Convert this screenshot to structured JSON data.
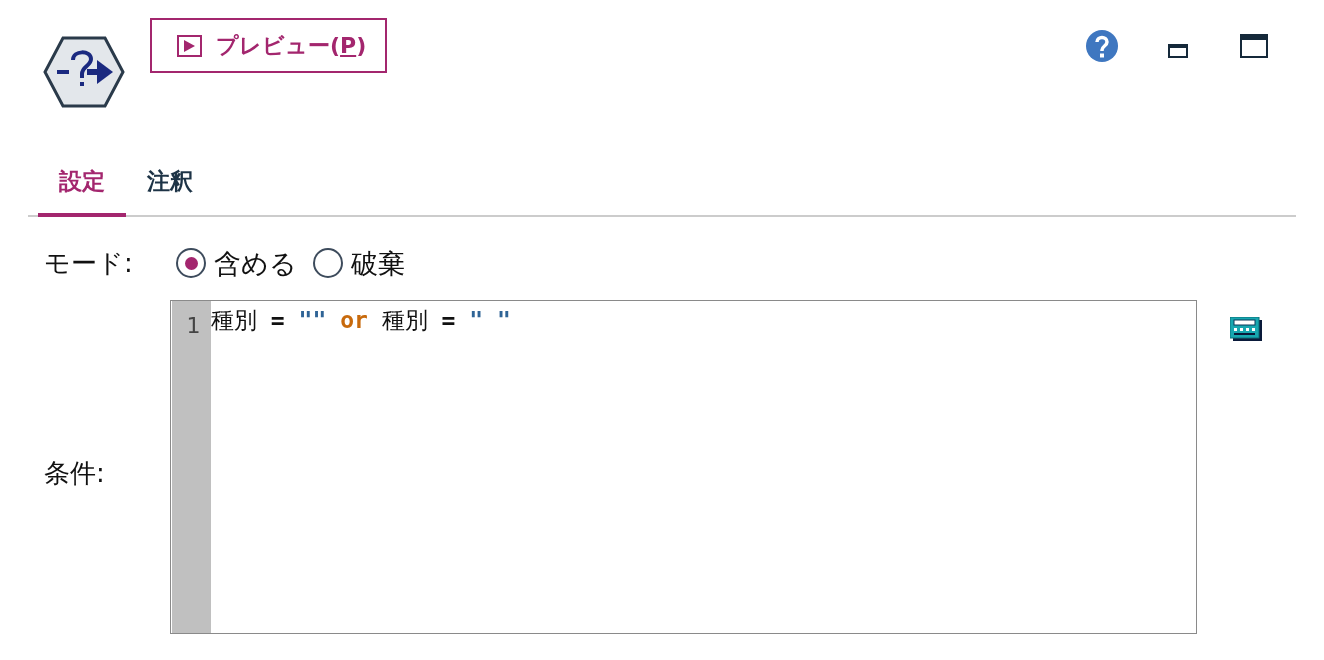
{
  "toolbar": {
    "preview_button": {
      "label": "プレビュー",
      "shortcut": "(P)"
    }
  },
  "tabs": [
    {
      "label": "設定",
      "selected": true
    },
    {
      "label": "注釈",
      "selected": false
    }
  ],
  "mode": {
    "label": "モード:",
    "options": [
      {
        "label": "含める",
        "selected": true
      },
      {
        "label": "破棄",
        "selected": false
      }
    ]
  },
  "condition": {
    "label": "条件:",
    "lines": [
      {
        "number": "1",
        "tokens": [
          {
            "kind": "identifier",
            "text": "種別"
          },
          {
            "kind": "operator",
            "text": "="
          },
          {
            "kind": "string",
            "text": "\"\""
          },
          {
            "kind": "keyword",
            "text": "or"
          },
          {
            "kind": "identifier",
            "text": "種別"
          },
          {
            "kind": "operator",
            "text": "="
          },
          {
            "kind": "string",
            "text": "\" \""
          }
        ]
      }
    ]
  }
}
